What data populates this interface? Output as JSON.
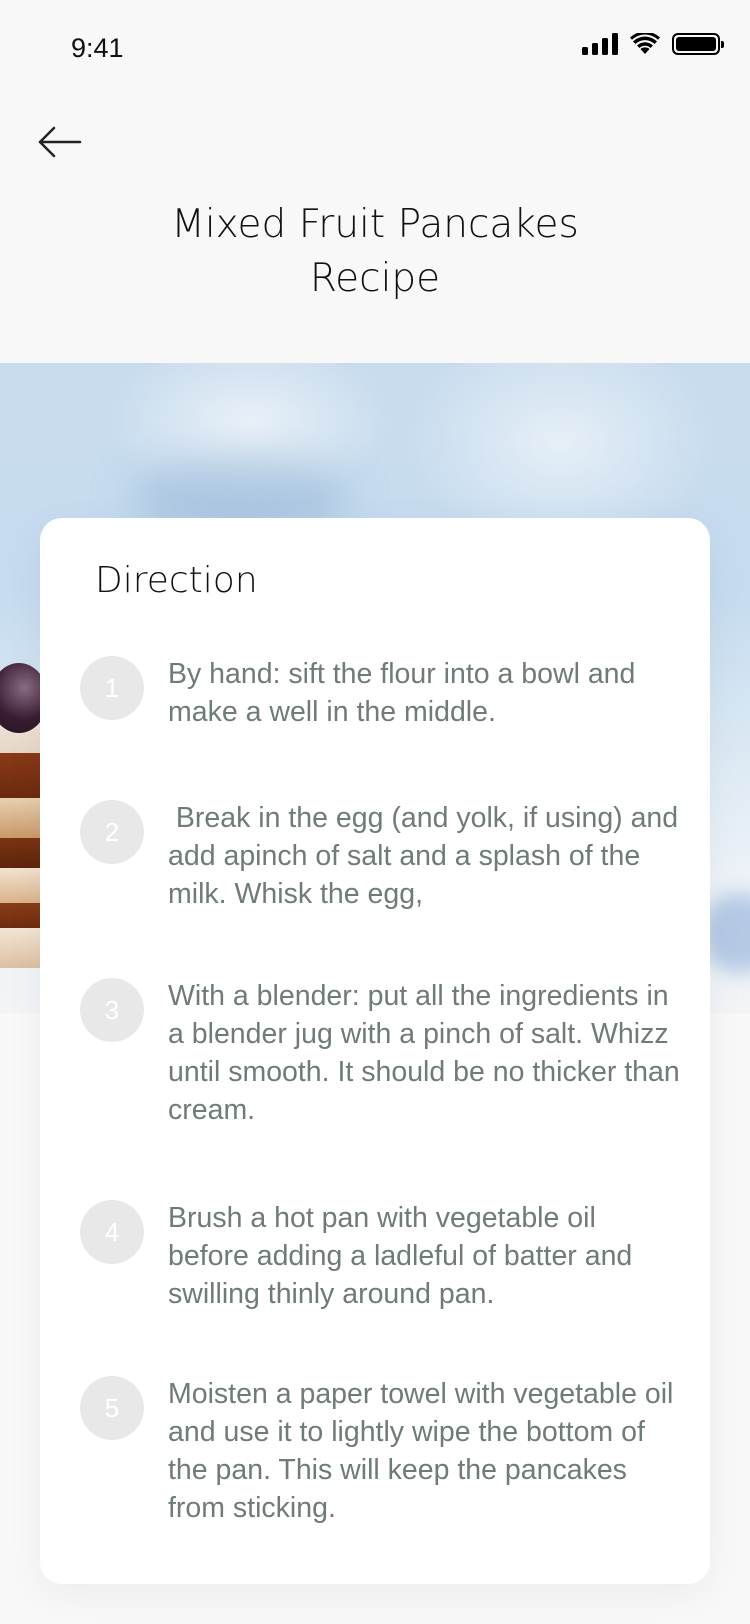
{
  "status_bar": {
    "time": "9:41",
    "icons": [
      "signal-icon",
      "wifi-icon",
      "battery-icon"
    ]
  },
  "header": {
    "back_icon": "arrow-left-icon",
    "title": "Mixed Fruit Pancakes Recipe"
  },
  "directions": {
    "heading": "Direction",
    "steps": [
      {
        "number": "1",
        "text": "By hand: sift the flour into a bowl and make a well in the middle."
      },
      {
        "number": "2",
        "text": " Break in the egg (and yolk, if using) and add apinch of salt and a splash of the milk. Whisk the egg,"
      },
      {
        "number": "3",
        "text": "With a blender: put all the ingredients in a blender jug with a pinch of salt. Whizz until smooth. It should be no thicker than cream."
      },
      {
        "number": "4",
        "text": "Brush a hot pan with vegetable oil before adding a ladleful of batter and swilling thinly around pan."
      },
      {
        "number": "5",
        "text": "Moisten a paper towel with vegetable oil and use it to lightly wipe the bottom of the pan. This will keep the pancakes from sticking."
      }
    ]
  },
  "colors": {
    "background": "#f8f8f8",
    "card": "#ffffff",
    "step_text": "#6f7b79",
    "step_circle": "#e8e8e8"
  }
}
